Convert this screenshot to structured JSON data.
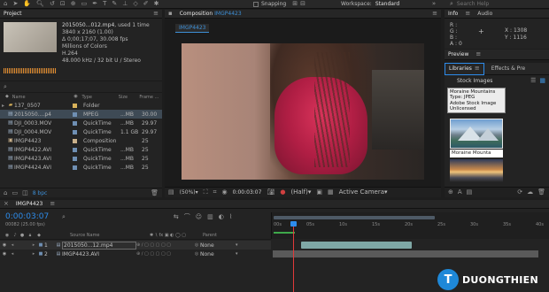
{
  "toolbar": {
    "snapping_label": "Snapping",
    "workspace_label": "Workspace:",
    "workspace_value": "Standard",
    "search_placeholder": "Search Help"
  },
  "project": {
    "tab_label": "Project",
    "filename": "2015050...012.mp4",
    "used": ", used 1 time",
    "resolution": "3840 x 2160 (1.00)",
    "duration": "Δ 0;00;17;07, 30.008 fps",
    "colors": "Millions of Colors",
    "codec": "H.264",
    "audio": "48.000 kHz / 32 bit U / Stereo",
    "columns": {
      "name": "Name",
      "type": "Type",
      "size": "Size",
      "frame": "Frame ..."
    },
    "items": [
      {
        "name": "137_0507",
        "type": "Folder",
        "size": "",
        "frame": "",
        "icon": "folder",
        "label_color": "#d8b25a"
      },
      {
        "name": "2015050....p4",
        "type": "MPEG",
        "size": "...MB",
        "frame": "30.00",
        "icon": "video",
        "label_color": "#6f8fb3"
      },
      {
        "name": "DJI_0003.MOV",
        "type": "QuickTime",
        "size": "...MB",
        "frame": "29.97",
        "icon": "video",
        "label_color": "#6f8fb3"
      },
      {
        "name": "DJI_0004.MOV",
        "type": "QuickTime",
        "size": "1.1 GB",
        "frame": "29.97",
        "icon": "video",
        "label_color": "#6f8fb3"
      },
      {
        "name": "IMGP4423",
        "type": "Composition",
        "size": "",
        "frame": "25",
        "icon": "comp",
        "label_color": "#c9b08a"
      },
      {
        "name": "IMGP4422.AVI",
        "type": "QuickTime",
        "size": "...MB",
        "frame": "25",
        "icon": "video",
        "label_color": "#6f8fb3"
      },
      {
        "name": "IMGP4423.AVI",
        "type": "QuickTime",
        "size": "...MB",
        "frame": "25",
        "icon": "video",
        "label_color": "#6f8fb3"
      },
      {
        "name": "IMGP4424.AVI",
        "type": "QuickTime",
        "size": "...MB",
        "frame": "25",
        "icon": "video",
        "label_color": "#6f8fb3"
      }
    ],
    "bpc": "8 bpc"
  },
  "composition": {
    "tab_label": "Composition IMGP4423",
    "tab_prefix": "Composition",
    "tab_name": "IMGP4423",
    "comp_tab": "IMGP4423",
    "zoom": "(50%)",
    "timecode": "0:00:03:07",
    "resolution": "(Half)",
    "camera": "Active Camera"
  },
  "info": {
    "tab_info": "Info",
    "tab_audio": "Audio",
    "r": "R :",
    "g": "G :",
    "b": "B :",
    "a": "A : 0",
    "x": "X : 1308",
    "y": "Y : 1116"
  },
  "preview": {
    "tab_label": "Preview"
  },
  "libraries": {
    "tab_libraries": "Libraries",
    "tab_effects": "Effects & Pre",
    "dropdown": "Stock Images",
    "tooltip": [
      "Moraine Mountains",
      "Type: JPEG",
      "Adobe Stock Image",
      "Unlicensed"
    ],
    "thumb_label": "Moraine Mounta"
  },
  "timeline": {
    "tab_label": "IMGP4423",
    "timecode": "0:00:03:07",
    "frames": "00082 (25.00 fps)",
    "col_source": "Source Name",
    "col_parent": "Parent",
    "ruler": [
      "00s",
      "05s",
      "10s",
      "15s",
      "20s",
      "25s",
      "30s",
      "35s",
      "40s"
    ],
    "layers": [
      {
        "num": "1",
        "name": "2015050...12.mp4",
        "parent": "None",
        "selected": true
      },
      {
        "num": "2",
        "name": "IMGP4423.AVI",
        "parent": "None",
        "selected": false
      }
    ],
    "playhead_fraction": 0.078
  },
  "watermark": {
    "text": "DUONGTHIEN"
  },
  "colors": {
    "accent": "#2d8ceb",
    "timecode": "#2d8ceb",
    "layer_bar": "#7fa8a6"
  }
}
